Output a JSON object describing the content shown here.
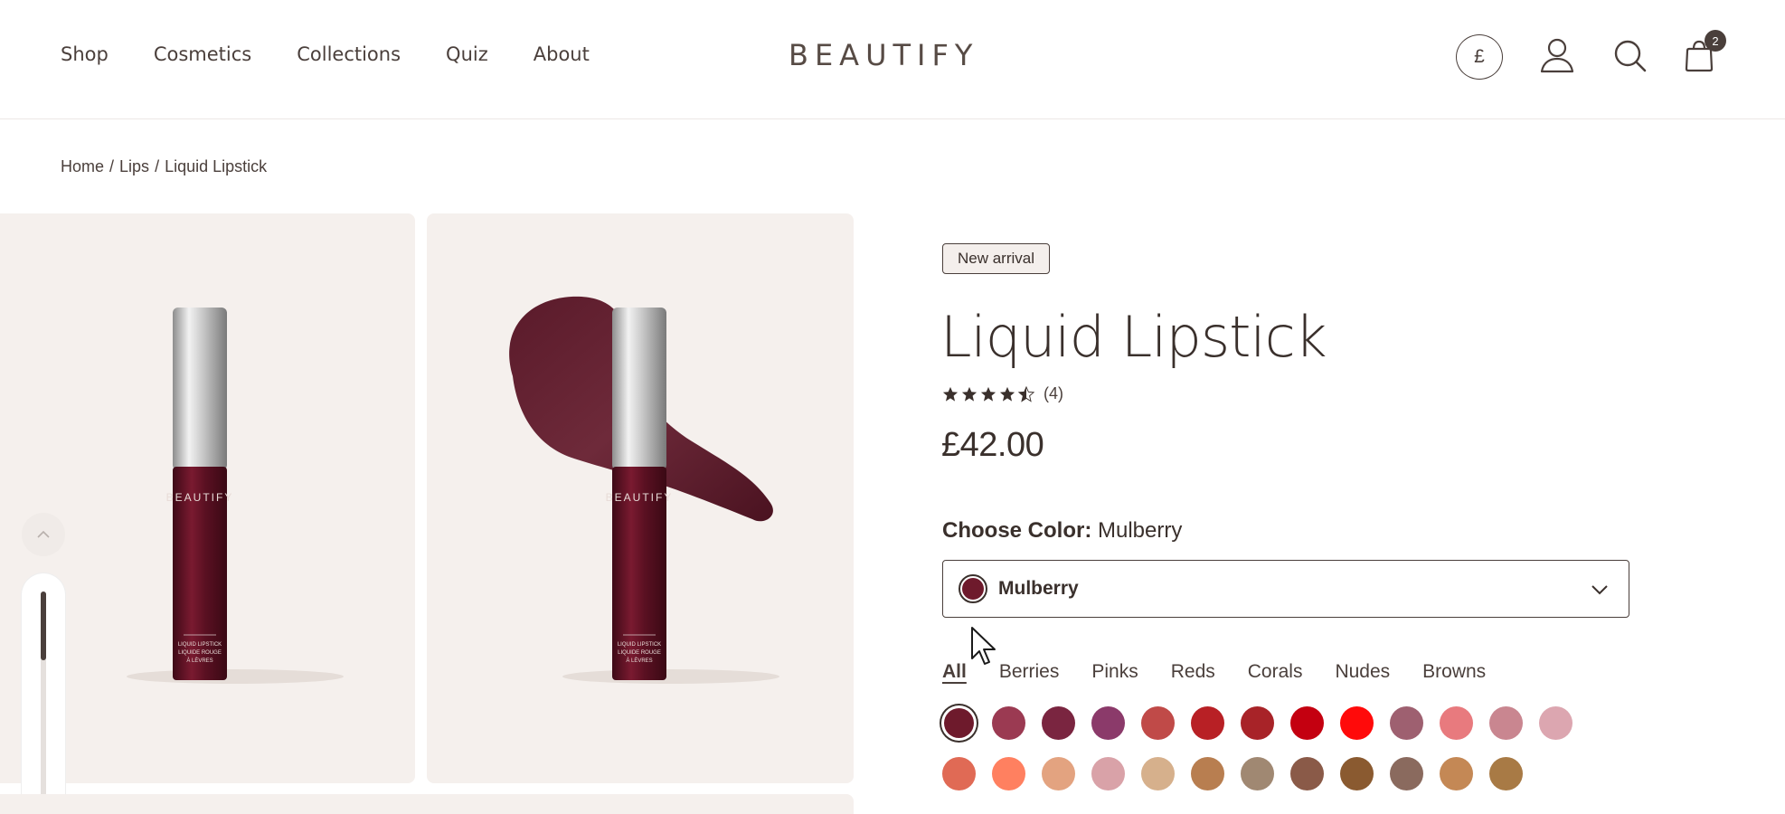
{
  "header": {
    "nav": [
      "Shop",
      "Cosmetics",
      "Collections",
      "Quiz",
      "About"
    ],
    "logo": "BEAUTIFY",
    "currency": "£",
    "cart_count": "2",
    "icons": [
      "user-icon",
      "search-icon",
      "bag-icon"
    ]
  },
  "breadcrumb": {
    "home": "Home",
    "sep": "/",
    "category": "Lips",
    "current": "Liquid Lipstick"
  },
  "gallery": {
    "product_label": "BEAUTIFY",
    "tube_text": "LIQUID LIPSTICK\nLIQUIDE ROUGE\nÀ LÈVRES"
  },
  "product": {
    "badge": "New arrival",
    "title": "Liquid Lipstick",
    "rating": 4.5,
    "review_count": "(4)",
    "price": "£42.00",
    "color_label": "Choose Color:",
    "color_selected": "Mulberry",
    "select_value": "Mulberry",
    "selected_color": "#6e1a2c"
  },
  "filters": {
    "items": [
      "All",
      "Berries",
      "Pinks",
      "Reds",
      "Corals",
      "Nudes",
      "Browns"
    ],
    "active": "All"
  },
  "swatches": {
    "row1": [
      "#6e1a2c",
      "#9b3a52",
      "#7a2540",
      "#8b3a6a",
      "#c04a48",
      "#b82025",
      "#a82328",
      "#c40010",
      "#ff0a0a",
      "#9e6070",
      "#e87a7e",
      "#c98690",
      "#dca6b0"
    ],
    "row2": [
      "#e06a55",
      "#ff8060",
      "#e3a380",
      "#d9a2a8",
      "#d6b08c",
      "#b87e50",
      "#a08872",
      "#8a5a48",
      "#8a5a30",
      "#8a6a5e",
      "#c48855",
      "#a87a45"
    ]
  },
  "colors": {
    "text": "#3a302c",
    "gallery_bg": "#f5f0ed",
    "tube_cap": "#d9d9d9",
    "tube_body": "#5a1022"
  }
}
